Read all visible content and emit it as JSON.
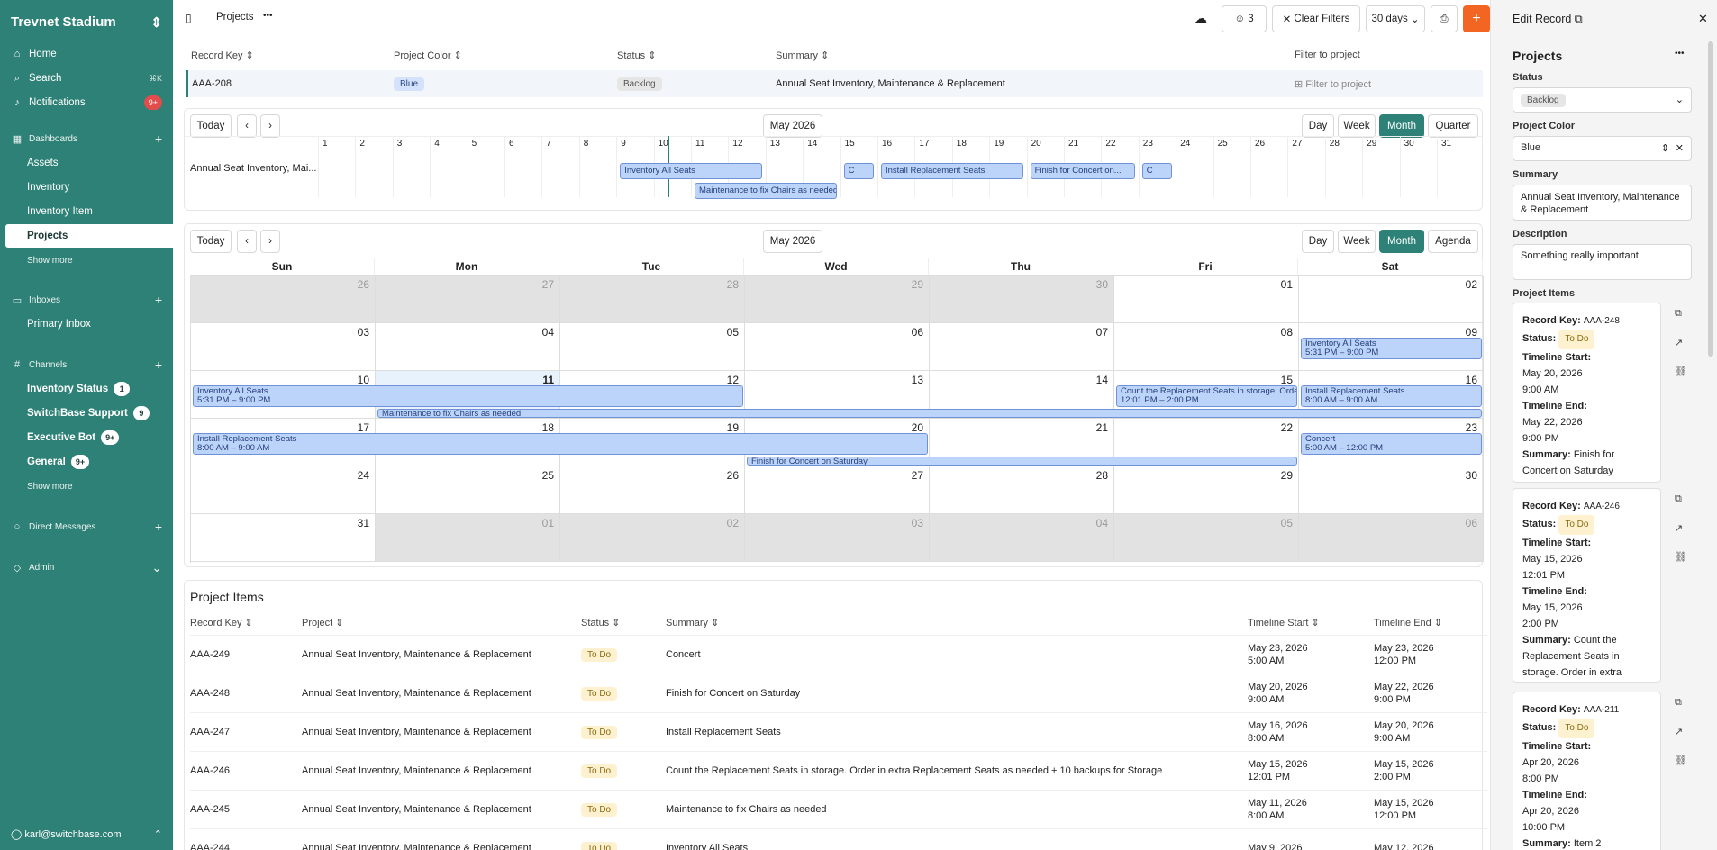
{
  "sidebar": {
    "workspace": "Trevnet Stadium",
    "home": "Home",
    "search": "Search",
    "search_kbd": "⌘K",
    "notifications": "Notifications",
    "notif_badge": "9+",
    "dashboards": "Dashboards",
    "dash_items": [
      "Assets",
      "Inventory",
      "Inventory Item",
      "Projects"
    ],
    "show_more": "Show more",
    "inboxes": "Inboxes",
    "primary_inbox": "Primary Inbox",
    "channels": "Channels",
    "channel_items": [
      {
        "label": "Inventory Status",
        "badge": "1"
      },
      {
        "label": "SwitchBase Support",
        "badge": "9"
      },
      {
        "label": "Executive Bot",
        "badge": "9+"
      },
      {
        "label": "General",
        "badge": "9+"
      }
    ],
    "show_more2": "Show more",
    "dms": "Direct Messages",
    "admin": "Admin",
    "user": "karl@switchbase.com"
  },
  "topbar": {
    "crumb": "Projects",
    "more": "•••",
    "users_count": "3",
    "clear_filters": "Clear Filters",
    "range": "30 days",
    "add": "+"
  },
  "grid": {
    "headers": [
      "Record Key",
      "Project Color",
      "Status",
      "Summary",
      "Filter to project"
    ],
    "row": {
      "key": "AAA-208",
      "color": "Blue",
      "status": "Backlog",
      "summary": "Annual Seat Inventory, Maintenance & Replacement",
      "filter": "Filter to project"
    }
  },
  "timeline": {
    "today": "Today",
    "prev": "‹",
    "next": "›",
    "month": "May 2026",
    "views": [
      "Day",
      "Week",
      "Month",
      "Quarter"
    ],
    "active": "Month",
    "row_label": "Annual Seat Inventory, Mai...",
    "days": [
      "1",
      "2",
      "3",
      "4",
      "5",
      "6",
      "7",
      "8",
      "9",
      "10",
      "11",
      "12",
      "13",
      "14",
      "15",
      "16",
      "17",
      "18",
      "19",
      "20",
      "21",
      "22",
      "23",
      "24",
      "25",
      "26",
      "27",
      "28",
      "29",
      "30",
      "31"
    ],
    "events": [
      {
        "label": "Inventory All Seats",
        "start": 9,
        "end": 12,
        "lane": 0
      },
      {
        "label": "C",
        "start": 15,
        "end": 15,
        "lane": 0
      },
      {
        "label": "Install Replacement Seats",
        "start": 16,
        "end": 19,
        "lane": 0
      },
      {
        "label": "Finish for Concert on...",
        "start": 20,
        "end": 22,
        "lane": 0
      },
      {
        "label": "C",
        "start": 23,
        "end": 23,
        "lane": 0
      },
      {
        "label": "Maintenance to fix Chairs as needed",
        "start": 11,
        "end": 14,
        "lane": 1
      }
    ]
  },
  "calendar": {
    "today": "Today",
    "prev": "‹",
    "next": "›",
    "month": "May 2026",
    "views": [
      "Day",
      "Week",
      "Month",
      "Agenda"
    ],
    "active": "Month",
    "weekdays": [
      "Sun",
      "Mon",
      "Tue",
      "Wed",
      "Thu",
      "Fri",
      "Sat"
    ],
    "weeks": [
      [
        "26",
        "27",
        "28",
        "29",
        "30",
        "01",
        "02"
      ],
      [
        "03",
        "04",
        "05",
        "06",
        "07",
        "08",
        "09"
      ],
      [
        "10",
        "11",
        "12",
        "13",
        "14",
        "15",
        "16"
      ],
      [
        "17",
        "18",
        "19",
        "20",
        "21",
        "22",
        "23"
      ],
      [
        "24",
        "25",
        "26",
        "27",
        "28",
        "29",
        "30"
      ],
      [
        "31",
        "01",
        "02",
        "03",
        "04",
        "05",
        "06"
      ]
    ],
    "events": [
      {
        "title": "Inventory All Seats",
        "time": "5:31 PM – 9:00 PM",
        "week": 1,
        "c0": 6,
        "c1": 6,
        "lane": 0
      },
      {
        "title": "Inventory All Seats",
        "time": "5:31 PM – 9:00 PM",
        "week": 2,
        "c0": 0,
        "c1": 2,
        "lane": 0
      },
      {
        "title": "Count the Replacement Seats in storage. Order...",
        "time": "12:01 PM – 2:00 PM",
        "week": 2,
        "c0": 5,
        "c1": 5,
        "lane": 0
      },
      {
        "title": "Install Replacement Seats",
        "time": "8:00 AM – 9:00 AM",
        "week": 2,
        "c0": 6,
        "c1": 6,
        "lane": 0
      },
      {
        "title": "Maintenance to fix Chairs as needed",
        "time": "",
        "week": 2,
        "c0": 1,
        "c1": 6,
        "lane": 1
      },
      {
        "title": "Install Replacement Seats",
        "time": "8:00 AM – 9:00 AM",
        "week": 3,
        "c0": 0,
        "c1": 3,
        "lane": 0
      },
      {
        "title": "Concert",
        "time": "5:00 AM – 12:00 PM",
        "week": 3,
        "c0": 6,
        "c1": 6,
        "lane": 0
      },
      {
        "title": "Finish for Concert on Saturday",
        "time": "",
        "week": 3,
        "c0": 3,
        "c1": 5,
        "lane": 1
      }
    ]
  },
  "project_items": {
    "title": "Project Items",
    "headers": [
      "Record Key",
      "Project",
      "Status",
      "Summary",
      "Timeline Start",
      "Timeline End"
    ],
    "rows": [
      {
        "key": "AAA-249",
        "project": "Annual Seat Inventory, Maintenance & Replacement",
        "status": "To Do",
        "summary": "Concert",
        "start1": "May 23, 2026",
        "start2": "5:00 AM",
        "end1": "May 23, 2026",
        "end2": "12:00 PM"
      },
      {
        "key": "AAA-248",
        "project": "Annual Seat Inventory, Maintenance & Replacement",
        "status": "To Do",
        "summary": "Finish for Concert on Saturday",
        "start1": "May 20, 2026",
        "start2": "9:00 AM",
        "end1": "May 22, 2026",
        "end2": "9:00 PM"
      },
      {
        "key": "AAA-247",
        "project": "Annual Seat Inventory, Maintenance & Replacement",
        "status": "To Do",
        "summary": "Install Replacement Seats",
        "start1": "May 16, 2026",
        "start2": "8:00 AM",
        "end1": "May 20, 2026",
        "end2": "9:00 AM"
      },
      {
        "key": "AAA-246",
        "project": "Annual Seat Inventory, Maintenance & Replacement",
        "status": "To Do",
        "summary": "Count the Replacement Seats in storage. Order in extra Replacement Seats as needed + 10 backups for Storage",
        "start1": "May 15, 2026",
        "start2": "12:01 PM",
        "end1": "May 15, 2026",
        "end2": "2:00 PM"
      },
      {
        "key": "AAA-245",
        "project": "Annual Seat Inventory, Maintenance & Replacement",
        "status": "To Do",
        "summary": "Maintenance to fix Chairs as needed",
        "start1": "May 11, 2026",
        "start2": "8:00 AM",
        "end1": "May 15, 2026",
        "end2": "12:00 PM"
      },
      {
        "key": "AAA-244",
        "project": "Annual Seat Inventory, Maintenance & Replacement",
        "status": "To Do",
        "summary": "Inventory All Seats",
        "start1": "May 9, 2026",
        "start2": "",
        "end1": "May 12, 2026",
        "end2": ""
      }
    ]
  },
  "edit": {
    "title": "Edit Record",
    "section": "Projects",
    "status_label": "Status",
    "status": "Backlog",
    "color_label": "Project Color",
    "color": "Blue",
    "summary_label": "Summary",
    "summary": "Annual Seat Inventory, Maintenance & Replacement",
    "desc_label": "Description",
    "desc": "Something really important",
    "items_label": "Project Items",
    "cards": [
      {
        "key": "AAA-248",
        "status": "To Do",
        "start1": "May 20, 2026",
        "start2": "9:00 AM",
        "end1": "May 22, 2026",
        "end2": "9:00 PM",
        "summary": "Finish for Concert on Saturday"
      },
      {
        "key": "AAA-246",
        "status": "To Do",
        "start1": "May 15, 2026",
        "start2": "12:01 PM",
        "end1": "May 15, 2026",
        "end2": "2:00 PM",
        "summary": "Count the Replacement Seats in storage. Order in extra Replacement ..."
      },
      {
        "key": "AAA-211",
        "status": "To Do",
        "start1": "Apr 20, 2026",
        "start2": "8:00 PM",
        "end1": "Apr 20, 2026",
        "end2": "10:00 PM",
        "summary": "Item 2"
      }
    ],
    "k_record": "Record Key:",
    "k_status": "Status:",
    "k_start": "Timeline Start:",
    "k_end": "Timeline End:",
    "k_summary": "Summary:"
  }
}
